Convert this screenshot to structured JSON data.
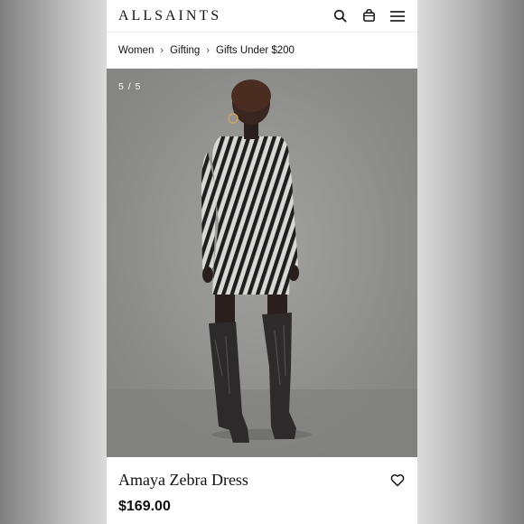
{
  "header": {
    "brand": "ALLSAINTS",
    "icons": [
      "search-icon",
      "bag-icon",
      "menu-icon"
    ]
  },
  "breadcrumb": {
    "items": [
      "Women",
      "Gifting",
      "Gifts Under $200"
    ]
  },
  "gallery": {
    "counter": "5 / 5"
  },
  "product": {
    "name": "Amaya Zebra Dress",
    "price": "$169.00",
    "wishlist_icon": "heart-icon"
  },
  "colors": {
    "text": "#111111",
    "background": "#ffffff"
  }
}
